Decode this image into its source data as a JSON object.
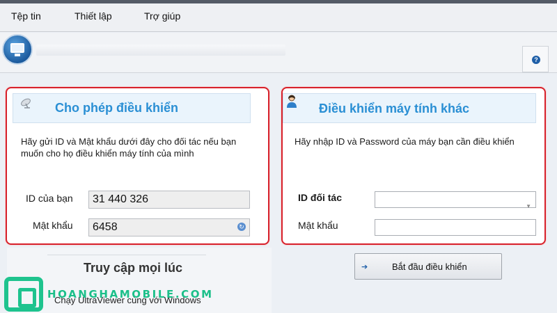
{
  "menu": {
    "items": [
      "Tệp tin",
      "Thiết lập",
      "Trợ giúp"
    ]
  },
  "header": {
    "help_label": "?"
  },
  "allow_panel": {
    "title": "Cho phép điều khiển",
    "description": "Hãy gửi ID và Mật khẩu dưới đây cho đối tác nếu bạn muốn cho họ điều khiển máy tính của mình",
    "id_label": "ID của bạn",
    "id_value": "31 440 326",
    "password_label": "Mật khẩu",
    "password_value": "6458"
  },
  "control_panel": {
    "title": "Điều khiển máy tính khác",
    "description": "Hãy nhập ID và Password của máy bạn cần điều khiển",
    "partner_id_label": "ID đối tác",
    "partner_id_value": "",
    "password_label": "Mật khẩu",
    "password_value": ""
  },
  "bottom": {
    "always_access_title": "Truy cập mọi lúc",
    "run_with_windows": "Chạy UltraViewer cùng với Windows",
    "start_control_button": "Bắt đầu điều khiển"
  },
  "watermark": {
    "text": "HOANGHAMOBILE.COM"
  },
  "colors": {
    "accent_title": "#2a8fd4",
    "highlight_border": "#d7212b",
    "watermark": "#1bbf89"
  },
  "icons": {
    "app_logo": "monitor-icon",
    "allow": "satellite-dish-icon",
    "control": "user-icon",
    "help": "help-icon",
    "start": "arrow-right-icon"
  }
}
